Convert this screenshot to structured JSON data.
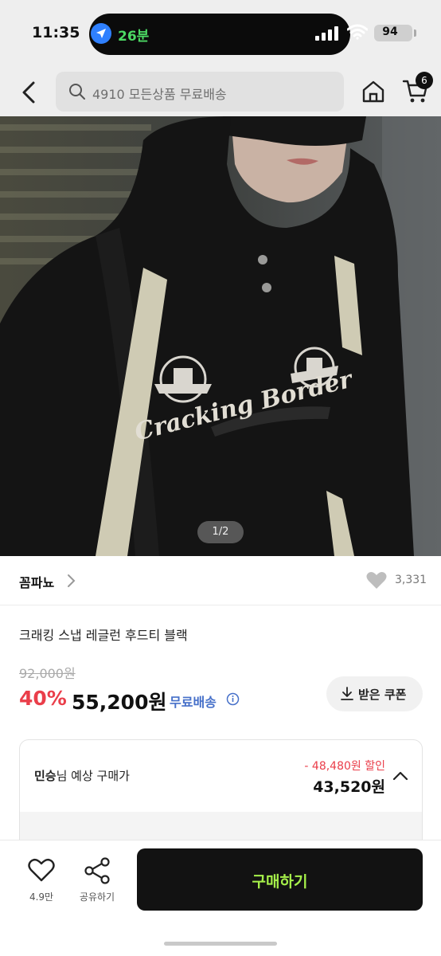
{
  "status_bar": {
    "time": "11:35",
    "navigation_eta": "26분",
    "battery": "94"
  },
  "header": {
    "search_placeholder": "4910 모든상품 무료배송",
    "cart_count": "6"
  },
  "gallery": {
    "counter": "1/2",
    "print_text": "Cracking Border"
  },
  "brand": {
    "name": "꼼파뇨",
    "like_count": "3,331"
  },
  "product": {
    "title": "크래킹 스냅 레글런 후드티 블랙",
    "original_price": "92,000원",
    "discount_rate": "40%",
    "sale_price": "55,200원",
    "shipping": "무료배송"
  },
  "coupon": {
    "label": "받은 쿠폰"
  },
  "expected_price": {
    "user_name": "민승",
    "label": "님 예상 구매가",
    "discount_text": "- 48,480원 할인",
    "price": "43,520원"
  },
  "bottom_bar": {
    "wish_count": "4.9만",
    "share_label": "공유하기",
    "buy_label": "구매하기"
  },
  "colors": {
    "discount_red": "#ea3e4a",
    "shipping_blue": "#4670c9",
    "buy_text_green": "#a6f04a",
    "buy_button_bg": "#121212"
  }
}
